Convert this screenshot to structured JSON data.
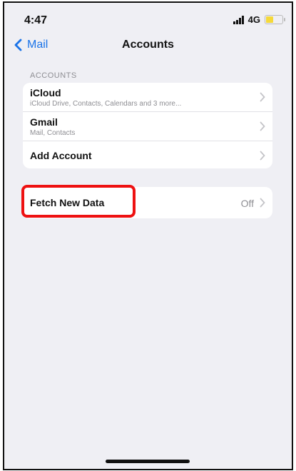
{
  "status_bar": {
    "time": "4:47",
    "network": "4G",
    "signal_icon": "signal-bars-icon",
    "battery_icon": "battery-icon",
    "battery_color": "#f5d93a"
  },
  "nav": {
    "back_label": "Mail",
    "title": "Accounts",
    "back_icon": "chevron-left-icon",
    "accent_color": "#1a73e8"
  },
  "accounts_section": {
    "header": "ACCOUNTS",
    "items": [
      {
        "title": "iCloud",
        "subtitle": "iCloud Drive, Contacts, Calendars and 3 more..."
      },
      {
        "title": "Gmail",
        "subtitle": "Mail, Contacts"
      },
      {
        "title": "Add Account"
      }
    ]
  },
  "fetch_section": {
    "title": "Fetch New Data",
    "value": "Off"
  },
  "annotation": {
    "highlight_color": "#e11111"
  }
}
